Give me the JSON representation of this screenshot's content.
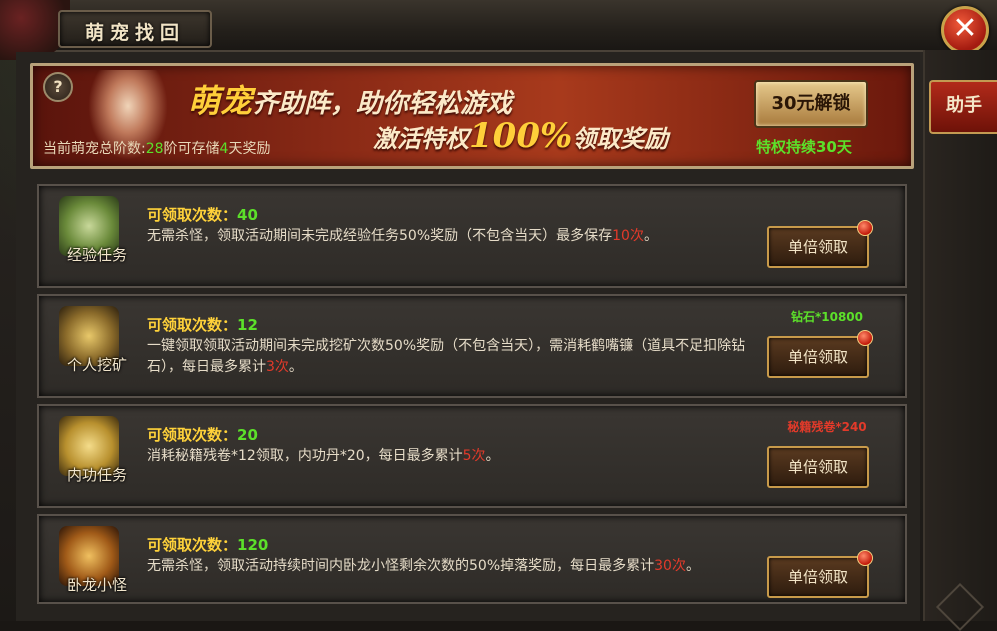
{
  "window": {
    "title": "萌宠找回",
    "close_icon": "✕"
  },
  "side": {
    "helper_tab": "助手"
  },
  "banner": {
    "help_icon": "?",
    "line1_highlight": "萌宠",
    "line1_rest": "齐助阵，助你轻松游戏",
    "line2_a": "激活特权",
    "line2_highlight": "100%",
    "line2_b": "领取奖励",
    "status_prefix": "当前萌宠总阶数:",
    "status_level": "28",
    "status_mid": "阶可存储",
    "status_days": "4",
    "status_suffix": "天奖励",
    "unlock_button": "30元解锁",
    "privilege_text": "特权持续30天"
  },
  "tasks": [
    {
      "name": "经验任务",
      "icon": "exp-scroll-icon",
      "count_label": "可领取次数：",
      "count_value": "40",
      "desc_main": "无需杀怪，领取活动期间未完成经验任务50%奖励（不包含当天）最多保存",
      "desc_highlight": "10次",
      "desc_tail": "。",
      "cost": "",
      "button": "单倍领取"
    },
    {
      "name": "个人挖矿",
      "icon": "pickaxe-icon",
      "count_label": "可领取次数：",
      "count_value": "12",
      "desc_main": "一键领取领取活动期间未完成挖矿次数50%奖励（不包含当天），需消耗鹤嘴镰（道具不足扣除钻石），每日最多累计",
      "desc_highlight": "3次",
      "desc_tail": "。",
      "cost": "钻石*10800",
      "button": "单倍领取"
    },
    {
      "name": "内功任务",
      "icon": "neigong-scroll-icon",
      "count_label": "可领取次数：",
      "count_value": "20",
      "desc_main": "消耗秘籍残卷*12领取，内功丹*20，每日最多累计",
      "desc_highlight": "5次",
      "desc_tail": "。",
      "cost": "秘籍残卷*240",
      "button": "单倍领取"
    },
    {
      "name": "卧龙小怪",
      "icon": "monster-skull-icon",
      "count_label": "可领取次数：",
      "count_value": "120",
      "desc_main": "无需杀怪，领取活动持续时间内卧龙小怪剩余次数的50%掉落奖励，每日最多累计",
      "desc_highlight": "30次",
      "desc_tail": "。",
      "cost": "",
      "button": "单倍领取"
    }
  ],
  "colors": {
    "count_yellow": "#ffd23a",
    "value_green": "#5ce02a",
    "highlight_red": "#e23a2a",
    "banner_red": "#8a2a16"
  }
}
